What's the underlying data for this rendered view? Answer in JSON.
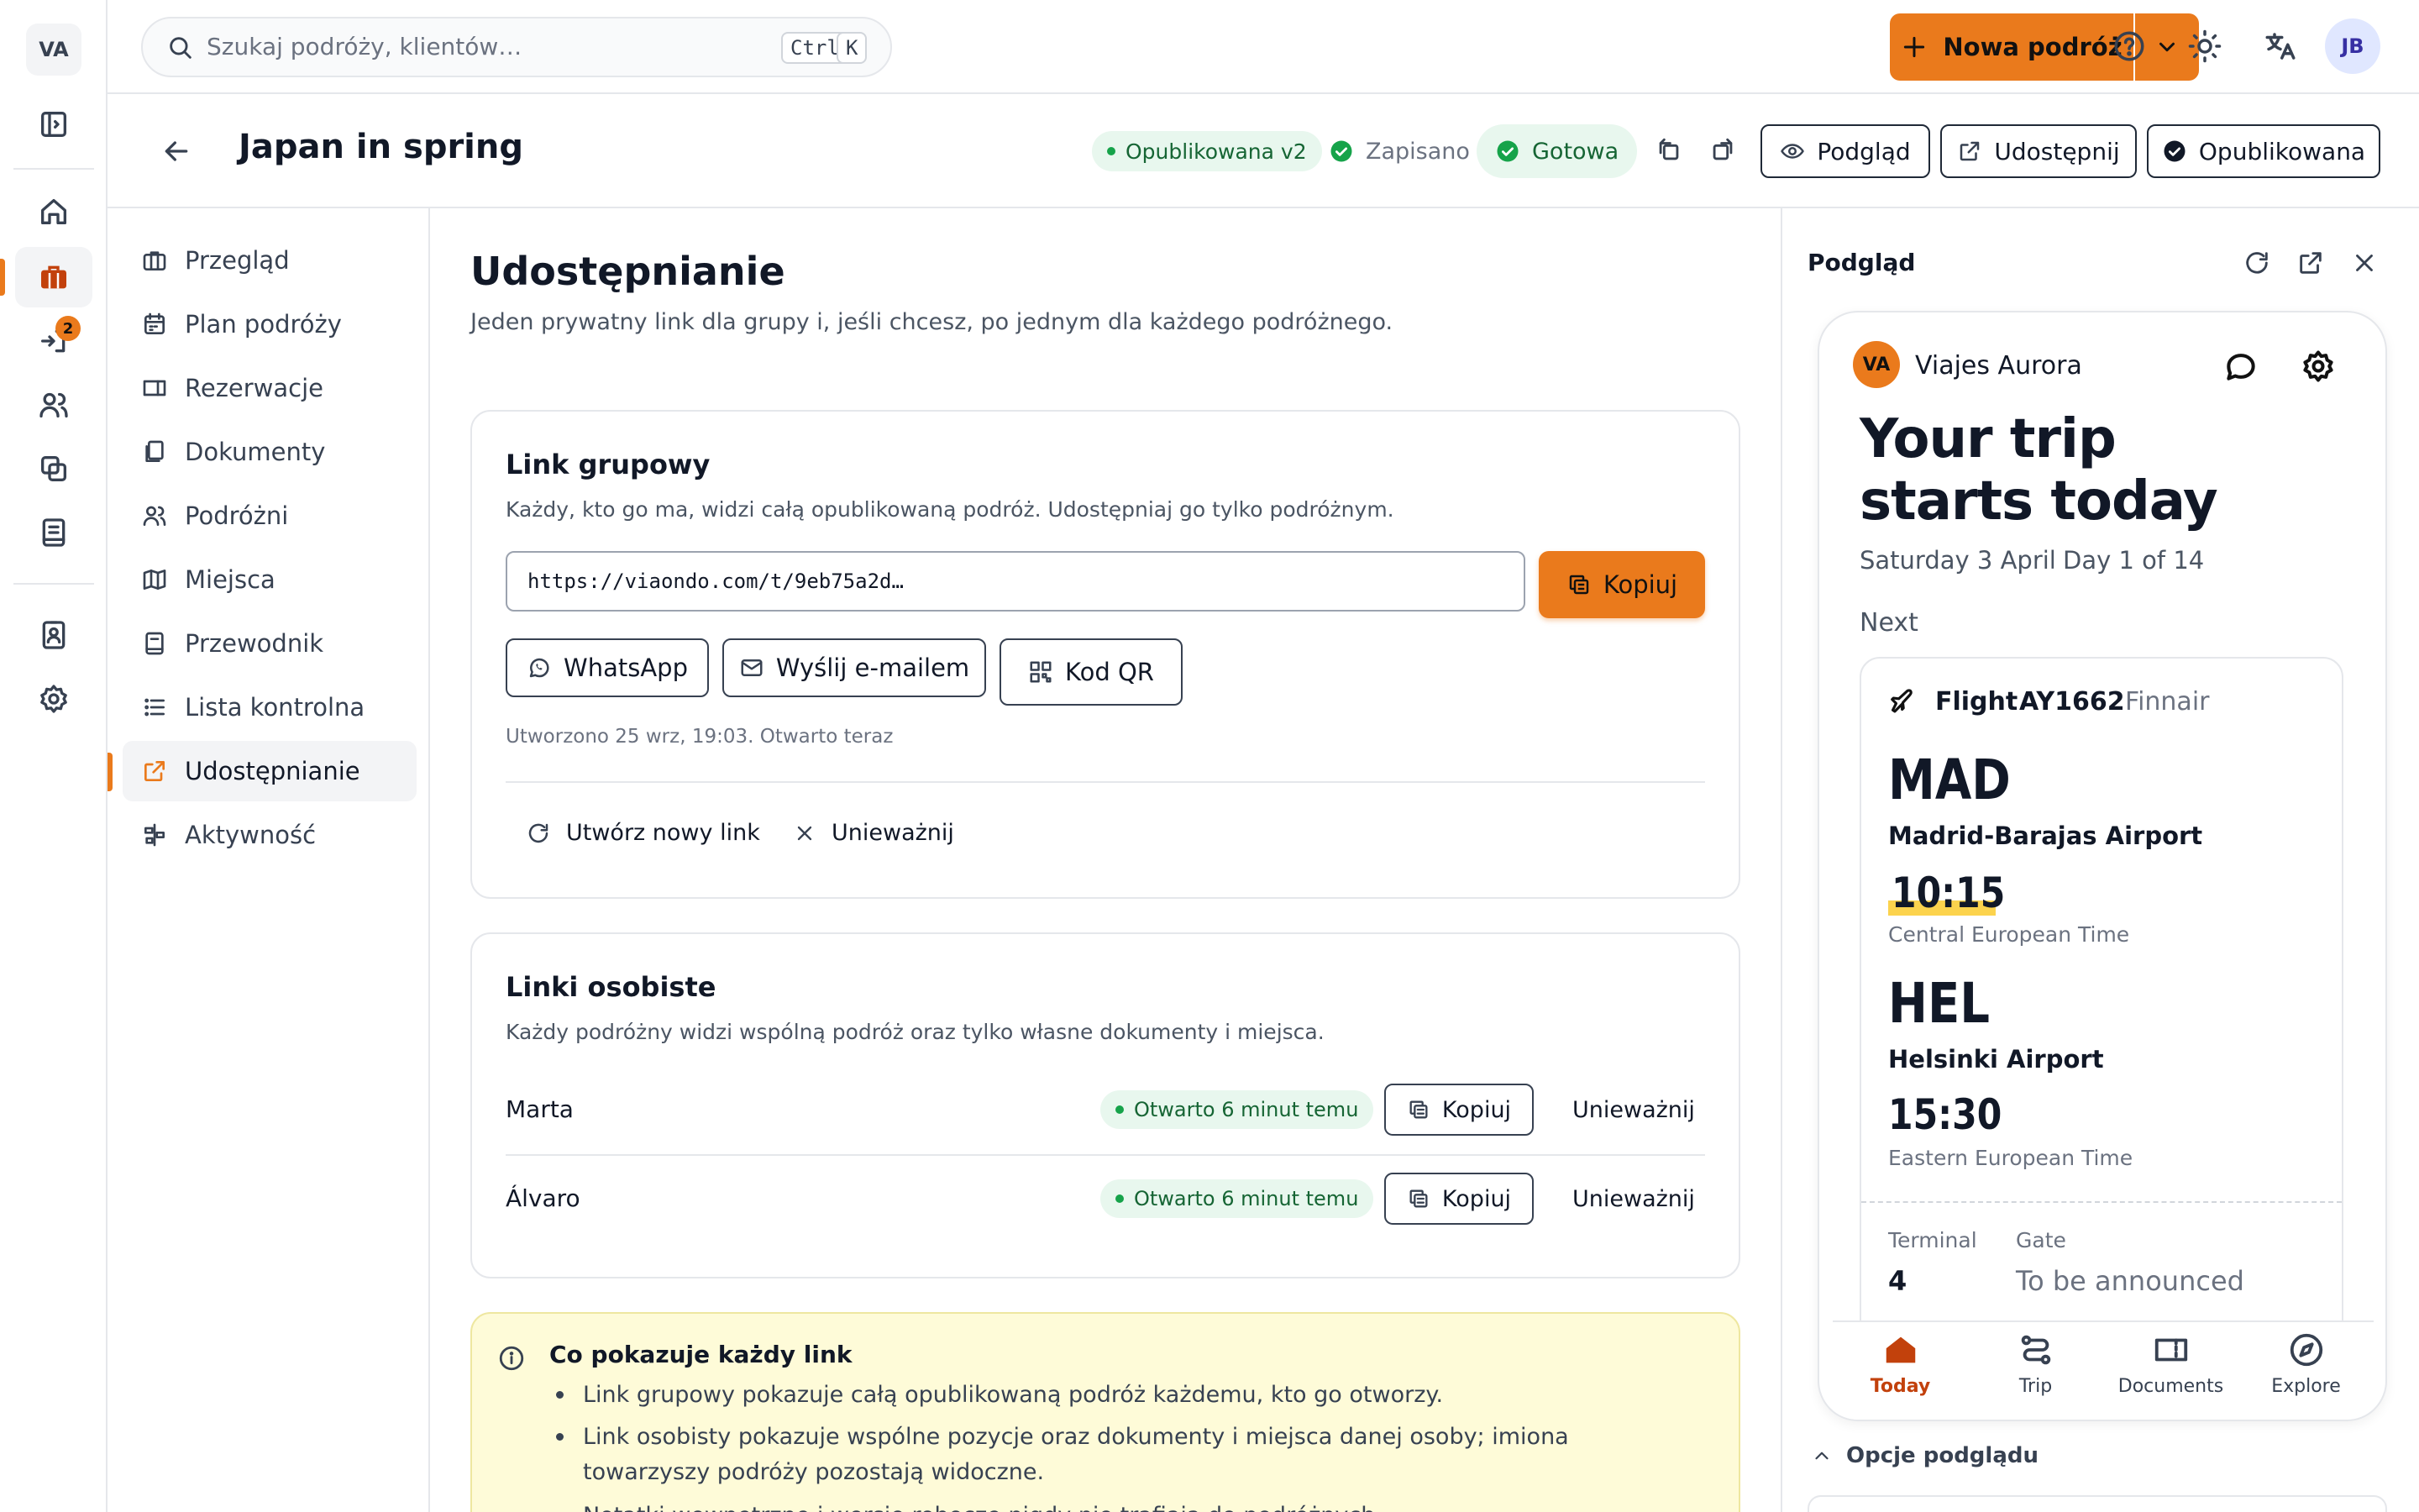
{
  "rail": {
    "logo": "VA",
    "badge_count": "2"
  },
  "topbar": {
    "search_placeholder": "Szukaj podróży, klientów…",
    "kbd_ctrl": "Ctrl",
    "kbd_k": "K",
    "new_trip_label": "Nowa podróż",
    "user_initials": "JB"
  },
  "header": {
    "title": "Japan in spring",
    "published_badge": "Opublikowana v2",
    "saved_label": "Zapisano",
    "ready_label": "Gotowa",
    "preview_button": "Podgląd",
    "share_button": "Udostępnij",
    "published_button": "Opublikowana"
  },
  "nav": {
    "items": [
      {
        "label": "Przegląd",
        "icon": "briefcase-icon"
      },
      {
        "label": "Plan podróży",
        "icon": "calendar-icon"
      },
      {
        "label": "Rezerwacje",
        "icon": "ticket-icon"
      },
      {
        "label": "Dokumenty",
        "icon": "documents-icon"
      },
      {
        "label": "Podróżni",
        "icon": "users-icon"
      },
      {
        "label": "Miejsca",
        "icon": "map-icon"
      },
      {
        "label": "Przewodnik",
        "icon": "book-icon"
      },
      {
        "label": "Lista kontrolna",
        "icon": "list-icon"
      },
      {
        "label": "Udostępnianie",
        "icon": "share-icon"
      },
      {
        "label": "Aktywność",
        "icon": "activity-icon"
      }
    ],
    "active_index": 8
  },
  "main": {
    "title": "Udostępnianie",
    "subtitle": "Jeden prywatny link dla grupy i, jeśli chcesz, po jednym dla każdego podróżnego.",
    "group": {
      "title": "Link grupowy",
      "description": "Każdy, kto go ma, widzi całą opublikowaną podróż. Udostępniaj go tylko podróżnym.",
      "url": "https://viaondo.com/t/9eb75a2d…",
      "copy_label": "Kopiuj",
      "whatsapp_label": "WhatsApp",
      "email_label": "Wyślij e-mailem",
      "qr_label": "Kod QR",
      "meta": "Utworzono 25 wrz, 19:03. Otwarto teraz",
      "regenerate_label": "Utwórz nowy link",
      "revoke_label": "Unieważnij"
    },
    "personal": {
      "title": "Linki osobiste",
      "description": "Każdy podróżny widzi wspólną podróż oraz tylko własne dokumenty i miejsca.",
      "rows": [
        {
          "name": "Marta",
          "status": "Otwarto 6 minut temu",
          "copy": "Kopiuj",
          "revoke": "Unieważnij"
        },
        {
          "name": "Álvaro",
          "status": "Otwarto 6 minut temu",
          "copy": "Kopiuj",
          "revoke": "Unieważnij"
        }
      ]
    },
    "info": {
      "title": "Co pokazuje każdy link",
      "bullets": [
        "Link grupowy pokazuje całą opublikowaną podróż każdemu, kto go otworzy.",
        "Link osobisty pokazuje wspólne pozycje oraz dokumenty i miejsca danej osoby; imiona towarzyszy podróży pozostają widoczne.",
        "Notatki wewnętrzne i wersje robocze nigdy nie trafiają do podróżnych."
      ]
    }
  },
  "preview": {
    "title": "Podgląd",
    "options_label": "Opcje podglądu",
    "phone": {
      "agency_initials": "VA",
      "agency_name": "Viajes Aurora",
      "headline_line1": "Your trip",
      "headline_line2": "starts today",
      "date": "Saturday 3 April",
      "day": "Day 1 of 14",
      "next_label": "Next",
      "flight": {
        "label": "Flight",
        "number": "AY1662",
        "airline": "Finnair",
        "from_code": "MAD",
        "from_airport": "Madrid-Barajas Airport",
        "dep_time": "10:15",
        "dep_tz": "Central European Time",
        "to_code": "HEL",
        "to_airport": "Helsinki Airport",
        "arr_time": "15:30",
        "arr_tz": "Eastern European Time",
        "terminal_label": "Terminal",
        "terminal": "4",
        "gate_label": "Gate",
        "gate": "To be announced"
      },
      "tabs": [
        "Today",
        "Trip",
        "Documents",
        "Explore"
      ]
    }
  },
  "colors": {
    "accent": "#ea7a1c",
    "success": "#16a34a",
    "success_bg": "#e8f7ee",
    "info_bg": "#fefbd8"
  }
}
